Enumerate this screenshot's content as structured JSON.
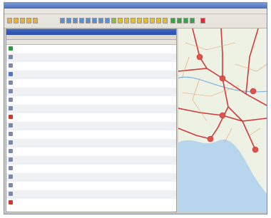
{
  "window": {
    "title": "",
    "menu": []
  },
  "toolbar": {
    "buttons": [
      {
        "name": "toolbar-btn-1",
        "color": "#e8b040"
      },
      {
        "name": "toolbar-btn-2",
        "color": "#e8b040"
      },
      {
        "name": "toolbar-btn-3",
        "color": "#e8b040"
      },
      {
        "name": "toolbar-btn-4",
        "color": "#e8b040"
      },
      {
        "name": "toolbar-btn-5",
        "color": "#e8b040"
      },
      {
        "name": "toolbar-btn-6",
        "color": "#5b8fd0"
      },
      {
        "name": "toolbar-btn-7",
        "color": "#5b8fd0"
      },
      {
        "name": "toolbar-btn-8",
        "color": "#5b8fd0"
      },
      {
        "name": "toolbar-btn-9",
        "color": "#5b8fd0"
      },
      {
        "name": "toolbar-btn-10",
        "color": "#5b8fd0"
      },
      {
        "name": "toolbar-btn-11",
        "color": "#5b8fd0"
      },
      {
        "name": "toolbar-btn-12",
        "color": "#5b8fd0"
      },
      {
        "name": "toolbar-btn-13",
        "color": "#5b8fd0"
      },
      {
        "name": "toolbar-btn-14",
        "color": "#8abf3a"
      },
      {
        "name": "toolbar-btn-15",
        "color": "#e0c030"
      },
      {
        "name": "toolbar-btn-16",
        "color": "#e0c030"
      },
      {
        "name": "toolbar-btn-17",
        "color": "#e0c030"
      },
      {
        "name": "toolbar-btn-18",
        "color": "#e0c030"
      },
      {
        "name": "toolbar-btn-19",
        "color": "#e0c030"
      },
      {
        "name": "toolbar-btn-20",
        "color": "#e0c030"
      },
      {
        "name": "toolbar-btn-21",
        "color": "#e0c030"
      },
      {
        "name": "toolbar-btn-22",
        "color": "#e0c030"
      },
      {
        "name": "toolbar-btn-23",
        "color": "#3aa04a"
      },
      {
        "name": "toolbar-btn-24",
        "color": "#3aa04a"
      },
      {
        "name": "toolbar-btn-25",
        "color": "#3aa04a"
      },
      {
        "name": "toolbar-btn-26",
        "color": "#3aa04a"
      },
      {
        "name": "toolbar-btn-27",
        "color": "#d03030"
      }
    ]
  },
  "route_panel": {
    "title": "",
    "tabs": [],
    "columns": [],
    "rows": [
      {
        "icon": "start-flag-icon",
        "icon_color": "#2e9a3e"
      },
      {
        "icon": "road-icon",
        "icon_color": "#7a8aa8"
      },
      {
        "icon": "road-icon",
        "icon_color": "#7a8aa8"
      },
      {
        "icon": "road-icon",
        "icon_color": "#4a7ad0"
      },
      {
        "icon": "road-icon",
        "icon_color": "#7a8aa8"
      },
      {
        "icon": "road-icon",
        "icon_color": "#7a8aa8"
      },
      {
        "icon": "road-icon",
        "icon_color": "#7a8aa8"
      },
      {
        "icon": "road-icon",
        "icon_color": "#7a8aa8"
      },
      {
        "icon": "waypoint-icon",
        "icon_color": "#d03a2a"
      },
      {
        "icon": "road-icon",
        "icon_color": "#7a8aa8"
      },
      {
        "icon": "road-icon",
        "icon_color": "#7a8aa8"
      },
      {
        "icon": "road-icon",
        "icon_color": "#7a8aa8"
      },
      {
        "icon": "road-icon",
        "icon_color": "#7a8aa8"
      },
      {
        "icon": "road-icon",
        "icon_color": "#7a8aa8"
      },
      {
        "icon": "road-icon",
        "icon_color": "#7a8aa8"
      },
      {
        "icon": "road-icon",
        "icon_color": "#7a8aa8"
      },
      {
        "icon": "road-icon",
        "icon_color": "#7a8aa8"
      },
      {
        "icon": "road-icon",
        "icon_color": "#7a8aa8"
      },
      {
        "icon": "finish-flag-icon",
        "icon_color": "#d03a2a"
      }
    ]
  },
  "map": {
    "sea_color": "#b7d6ee",
    "land_color": "#eef2e4",
    "road_color": "#d23a3a",
    "city_color": "#e0524e",
    "river_color": "#7fb0e0"
  },
  "colors": {
    "accent": "#3d66c4",
    "panel_bg": "#ffffff",
    "chrome": "#d4d0c8"
  }
}
